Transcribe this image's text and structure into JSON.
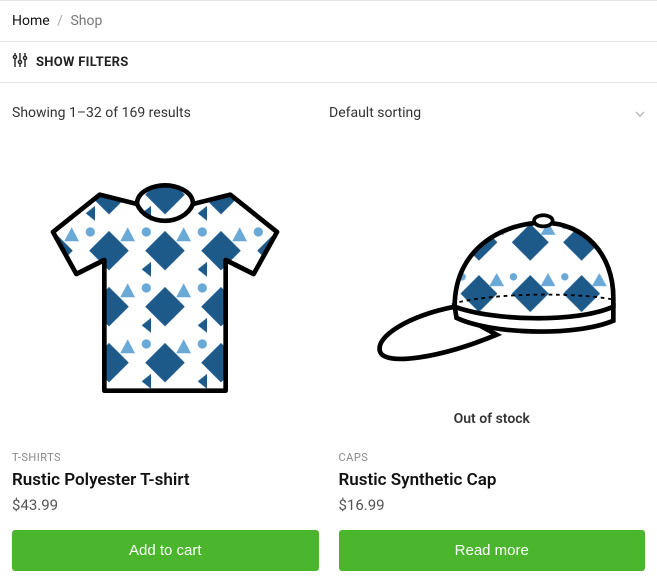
{
  "breadcrumb": {
    "home": "Home",
    "sep": "/",
    "current": "Shop"
  },
  "filters": {
    "label": "SHOW FILTERS"
  },
  "toolbar": {
    "result_text": "Showing 1–32 of 169 results",
    "sort_selected": "Default sorting"
  },
  "products": [
    {
      "category": "T-SHIRTS",
      "title": "Rustic Polyester T-shirt",
      "price": "$43.99",
      "button": "Add to cart",
      "out_of_stock": ""
    },
    {
      "category": "CAPS",
      "title": "Rustic Synthetic Cap",
      "price": "$16.99",
      "button": "Read more",
      "out_of_stock": "Out of stock"
    }
  ]
}
